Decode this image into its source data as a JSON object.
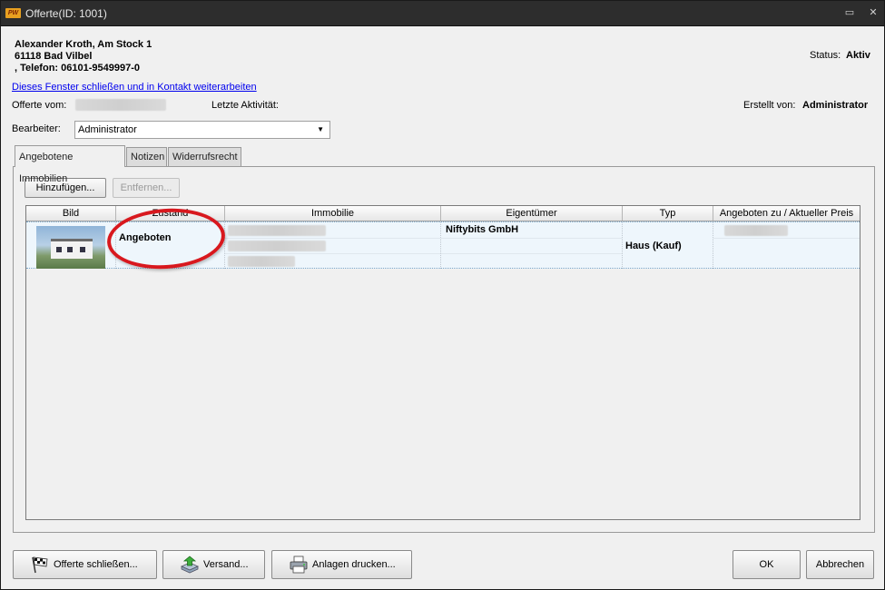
{
  "window": {
    "logo_text": "PW",
    "title": "Offerte(ID: 1001)",
    "minimize_glyph": "▭",
    "close_glyph": "✕"
  },
  "contact": {
    "line1": "Alexander Kroth, Am Stock 1",
    "line2": "61118 Bad Vilbel",
    "line3": ", Telefon: 06101-9549997-0"
  },
  "status": {
    "label": "Status:",
    "value": "Aktiv"
  },
  "link_close_continue": "Dieses Fenster schließen und in Kontakt weiterarbeiten",
  "offer_date_label": "Offerte vom:",
  "last_activity_label": "Letzte Aktivität:",
  "created_by": {
    "label": "Erstellt von:",
    "value": "Administrator"
  },
  "editor": {
    "label": "Bearbeiter:",
    "value": "Administrator"
  },
  "tabs": [
    {
      "label": "Angebotene Immobilien",
      "active": true
    },
    {
      "label": "Notizen",
      "active": false
    },
    {
      "label": "Widerrufsrecht",
      "active": false
    }
  ],
  "toolbar": {
    "add_label": "Hinzufügen...",
    "remove_label": "Entfernen..."
  },
  "grid": {
    "columns": [
      "Bild",
      "Zustand",
      "Immobilie",
      "Eigentümer",
      "Typ",
      "Angeboten zu / Aktueller Preis"
    ],
    "rows": [
      {
        "status": "Angeboten",
        "owner": "Niftybits GmbH",
        "type": "Haus (Kauf)"
      }
    ]
  },
  "bottom": {
    "close_offer_label": "Offerte schließen...",
    "send_label": "Versand...",
    "print_label": "Anlagen drucken...",
    "ok_label": "OK",
    "cancel_label": "Abbrechen"
  },
  "colors": {
    "titlebar": "#2d2d2d",
    "link": "#0000ee",
    "highlight_circle": "#d8181e",
    "row_selected": "#eef6fc"
  }
}
